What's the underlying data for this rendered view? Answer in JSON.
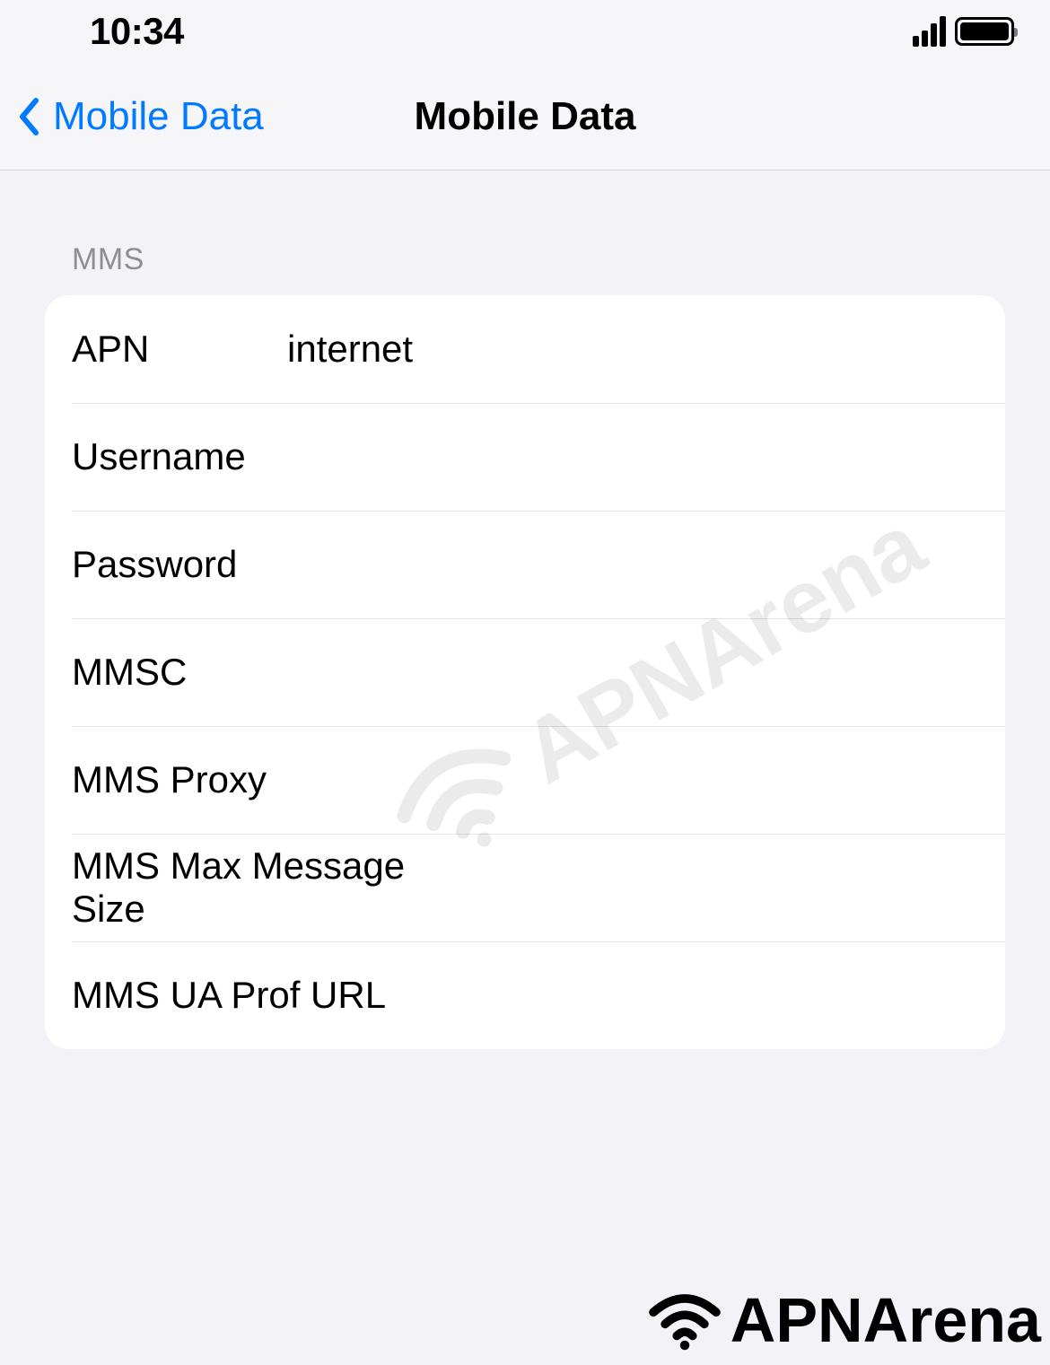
{
  "statusbar": {
    "time": "10:34"
  },
  "nav": {
    "back_label": "Mobile Data",
    "title": "Mobile Data"
  },
  "section": {
    "header": "MMS",
    "rows": [
      {
        "label": "APN",
        "value": "internet"
      },
      {
        "label": "Username",
        "value": ""
      },
      {
        "label": "Password",
        "value": ""
      },
      {
        "label": "MMSC",
        "value": ""
      },
      {
        "label": "MMS Proxy",
        "value": ""
      },
      {
        "label": "MMS Max Message Size",
        "value": ""
      },
      {
        "label": "MMS UA Prof URL",
        "value": ""
      }
    ]
  },
  "watermark": {
    "text": "APNArena"
  }
}
